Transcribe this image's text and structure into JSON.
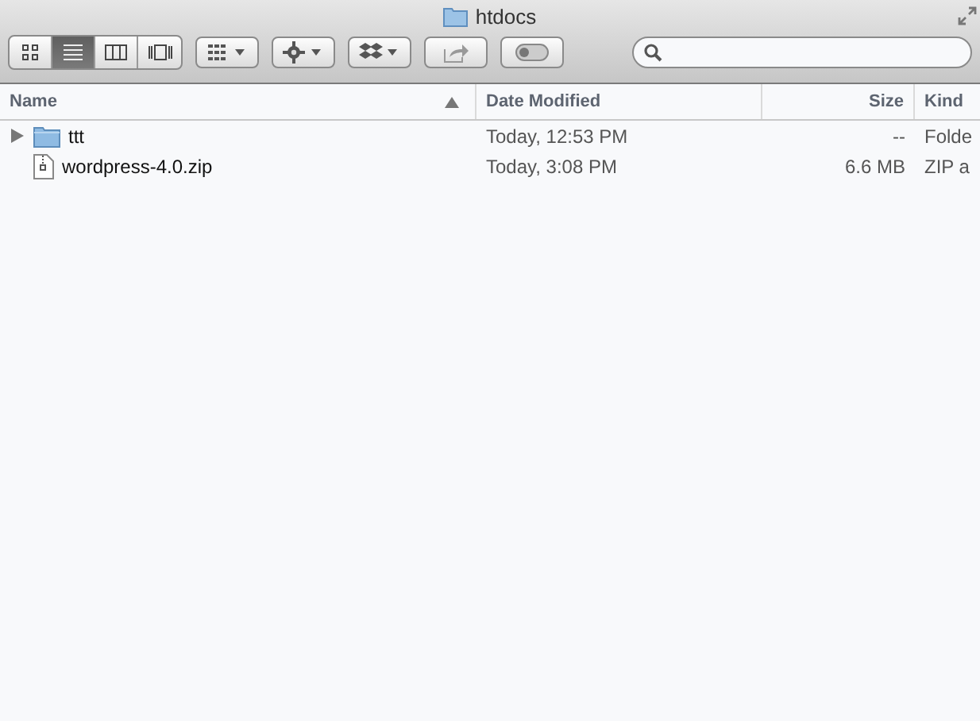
{
  "window": {
    "title": "htdocs"
  },
  "view_buttons": [
    {
      "kind": "icon",
      "selected": false
    },
    {
      "kind": "list",
      "selected": true
    },
    {
      "kind": "columns",
      "selected": false
    },
    {
      "kind": "coverflow",
      "selected": false
    }
  ],
  "toolbar_buttons": [
    {
      "kind": "arrange"
    },
    {
      "kind": "action"
    },
    {
      "kind": "dropbox"
    },
    {
      "kind": "share"
    },
    {
      "kind": "tags"
    }
  ],
  "columns": [
    {
      "label": "Name",
      "sorted": true
    },
    {
      "label": "Date Modified",
      "sorted": false
    },
    {
      "label": "Size",
      "sorted": false
    },
    {
      "label": "Kind",
      "sorted": false
    }
  ],
  "rows": [
    {
      "kind": "folder",
      "expanded": false,
      "name": "ttt",
      "date": "Today, 12:53 PM",
      "size": "--",
      "type": "Folde"
    },
    {
      "kind": "zip",
      "name": "wordpress-4.0.zip",
      "date": "Today, 3:08 PM",
      "size": "6.6 MB",
      "type": "ZIP a"
    }
  ]
}
